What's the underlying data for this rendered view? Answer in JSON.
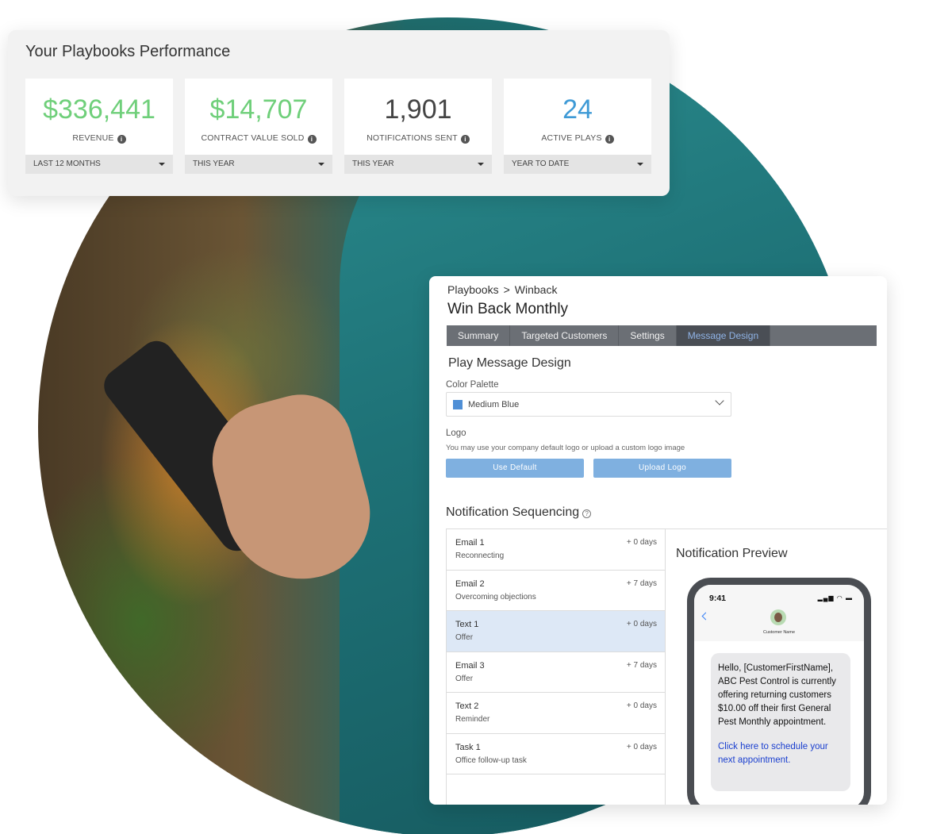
{
  "performance": {
    "title": "Your Playbooks Performance",
    "stats": [
      {
        "value": "$336,441",
        "label": "REVENUE",
        "period": "LAST 12 MONTHS",
        "color": "#6fcf7a"
      },
      {
        "value": "$14,707",
        "label": "CONTRACT VALUE SOLD",
        "period": "THIS YEAR",
        "color": "#6fcf7a"
      },
      {
        "value": "1,901",
        "label": "NOTIFICATIONS SENT",
        "period": "THIS YEAR",
        "color": "#444444"
      },
      {
        "value": "24",
        "label": "ACTIVE PLAYS",
        "period": "YEAR TO DATE",
        "color": "#3e9ad6"
      }
    ]
  },
  "editor": {
    "breadcrumb": {
      "root": "Playbooks",
      "current": "Winback"
    },
    "title": "Win Back Monthly",
    "tabs": [
      {
        "label": "Summary",
        "active": false
      },
      {
        "label": "Targeted Customers",
        "active": false
      },
      {
        "label": "Settings",
        "active": false
      },
      {
        "label": "Message Design",
        "active": true
      }
    ],
    "message_design_heading": "Play Message Design",
    "color_palette": {
      "label": "Color Palette",
      "value": "Medium Blue",
      "swatch": "#4f8fd6"
    },
    "logo": {
      "label": "Logo",
      "help": "You may use your company default logo or upload a custom logo image",
      "use_default": "Use Default",
      "upload": "Upload Logo"
    },
    "sequencing": {
      "heading": "Notification Sequencing",
      "items": [
        {
          "name": "Email 1",
          "sub": "Reconnecting",
          "delay": "+ 0 days",
          "selected": false
        },
        {
          "name": "Email 2",
          "sub": "Overcoming objections",
          "delay": "+ 7 days",
          "selected": false
        },
        {
          "name": "Text 1",
          "sub": "Offer",
          "delay": "+ 0 days",
          "selected": true
        },
        {
          "name": "Email 3",
          "sub": "Offer",
          "delay": "+ 7 days",
          "selected": false
        },
        {
          "name": "Text 2",
          "sub": "Reminder",
          "delay": "+ 0 days",
          "selected": false
        },
        {
          "name": "Task 1",
          "sub": "Office follow-up task",
          "delay": "+ 0 days",
          "selected": false
        }
      ]
    },
    "preview": {
      "heading": "Notification Preview",
      "phone_time": "9:41",
      "contact_name": "Customer Name",
      "message": "Hello, [CustomerFirstName], ABC Pest Control is currently offering returning customers $10.00 off their first General Pest Monthly appointment.",
      "link": "Click here to schedule your next appointment."
    }
  }
}
